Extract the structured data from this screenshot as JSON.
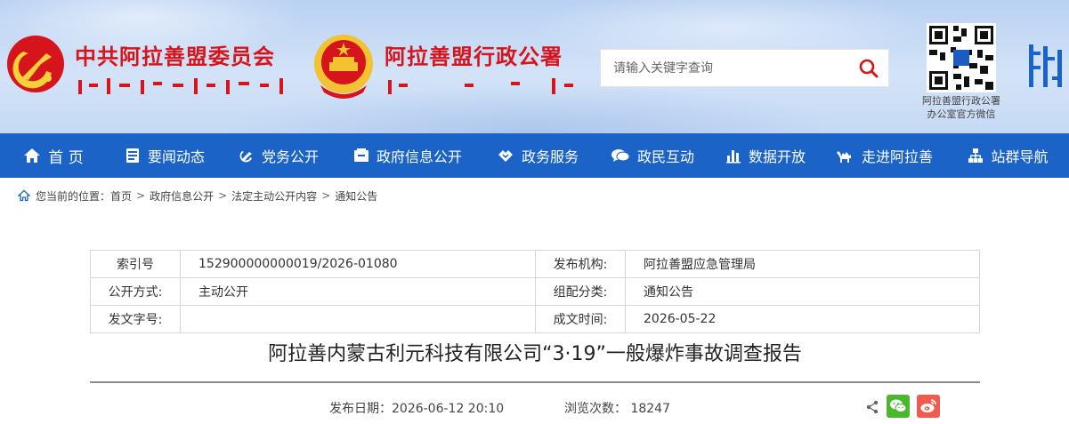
{
  "header": {
    "party_title": "中共阿拉善盟委员会",
    "gov_title": "阿拉善盟行政公署",
    "qr_caption_line1": "阿拉善盟行政公署",
    "qr_caption_line2": "办公室官方微信"
  },
  "search": {
    "placeholder": "请输入关键字查询",
    "value": ""
  },
  "nav": {
    "items": [
      {
        "label": "首 页",
        "icon": "home-icon"
      },
      {
        "label": "要闻动态",
        "icon": "news-icon"
      },
      {
        "label": "党务公开",
        "icon": "party-icon"
      },
      {
        "label": "政府信息公开",
        "icon": "info-box-icon"
      },
      {
        "label": "政务服务",
        "icon": "service-icon"
      },
      {
        "label": "政民互动",
        "icon": "chat-icon"
      },
      {
        "label": "数据开放",
        "icon": "bar-chart-icon"
      },
      {
        "label": "走进阿拉善",
        "icon": "camel-icon"
      },
      {
        "label": "站群导航",
        "icon": "sitemap-icon"
      }
    ]
  },
  "breadcrumb": {
    "prefix": "您当前的位置：",
    "items": [
      "首页",
      "政府信息公开",
      "法定主动公开内容",
      "通知公告"
    ]
  },
  "meta": {
    "index_label": "索引号",
    "index_value": "152900000000019/2026-01080",
    "publisher_label": "发布机构:",
    "publisher_value": "阿拉善盟应急管理局",
    "mode_label": "公开方式:",
    "mode_value": "主动公开",
    "category_label": "组配分类:",
    "category_value": "通知公告",
    "docno_label": "发文字号:",
    "docno_value": "",
    "created_label": "成文时间:",
    "created_value": "2026-05-22"
  },
  "article": {
    "title": "阿拉善内蒙古利元科技有限公司“3·19”一般爆炸事故调查报告",
    "publish_text": "发布日期：2026-06-12 20:10",
    "views_text": "浏览次数：  18247"
  },
  "colors": {
    "nav_bg": "#1b63c6",
    "title_red": "#d6141b",
    "wechat_green": "#4ab72e",
    "weibo_red": "#ef5c4f"
  }
}
